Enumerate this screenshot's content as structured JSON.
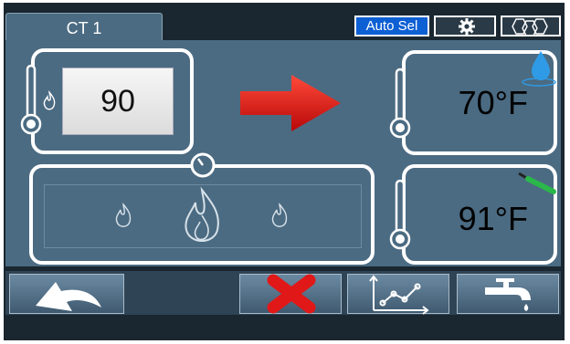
{
  "tab": {
    "label": "CT 1"
  },
  "toolbar": {
    "auto_sel_label": "Auto Sel",
    "gear_icon": "gear-icon",
    "dcn_icon": "dcn-icon"
  },
  "setpoint": {
    "value": "90"
  },
  "water_temp": {
    "value": "70°F",
    "icon": "water-drop-icon"
  },
  "flue_temp": {
    "value": "91°F",
    "icon": "probe-icon"
  },
  "flame": {
    "icons": [
      "small-flame-icon",
      "large-flame-icon",
      "small-flame-icon"
    ]
  },
  "bottom_bar": {
    "buttons": [
      "back-icon",
      "cancel-icon",
      "graph-icon",
      "tap-icon"
    ]
  },
  "colors": {
    "panel": "#4b6b82",
    "accent": "#0d5fd4",
    "arrow": "#e01818",
    "cancel": "#e01818"
  }
}
